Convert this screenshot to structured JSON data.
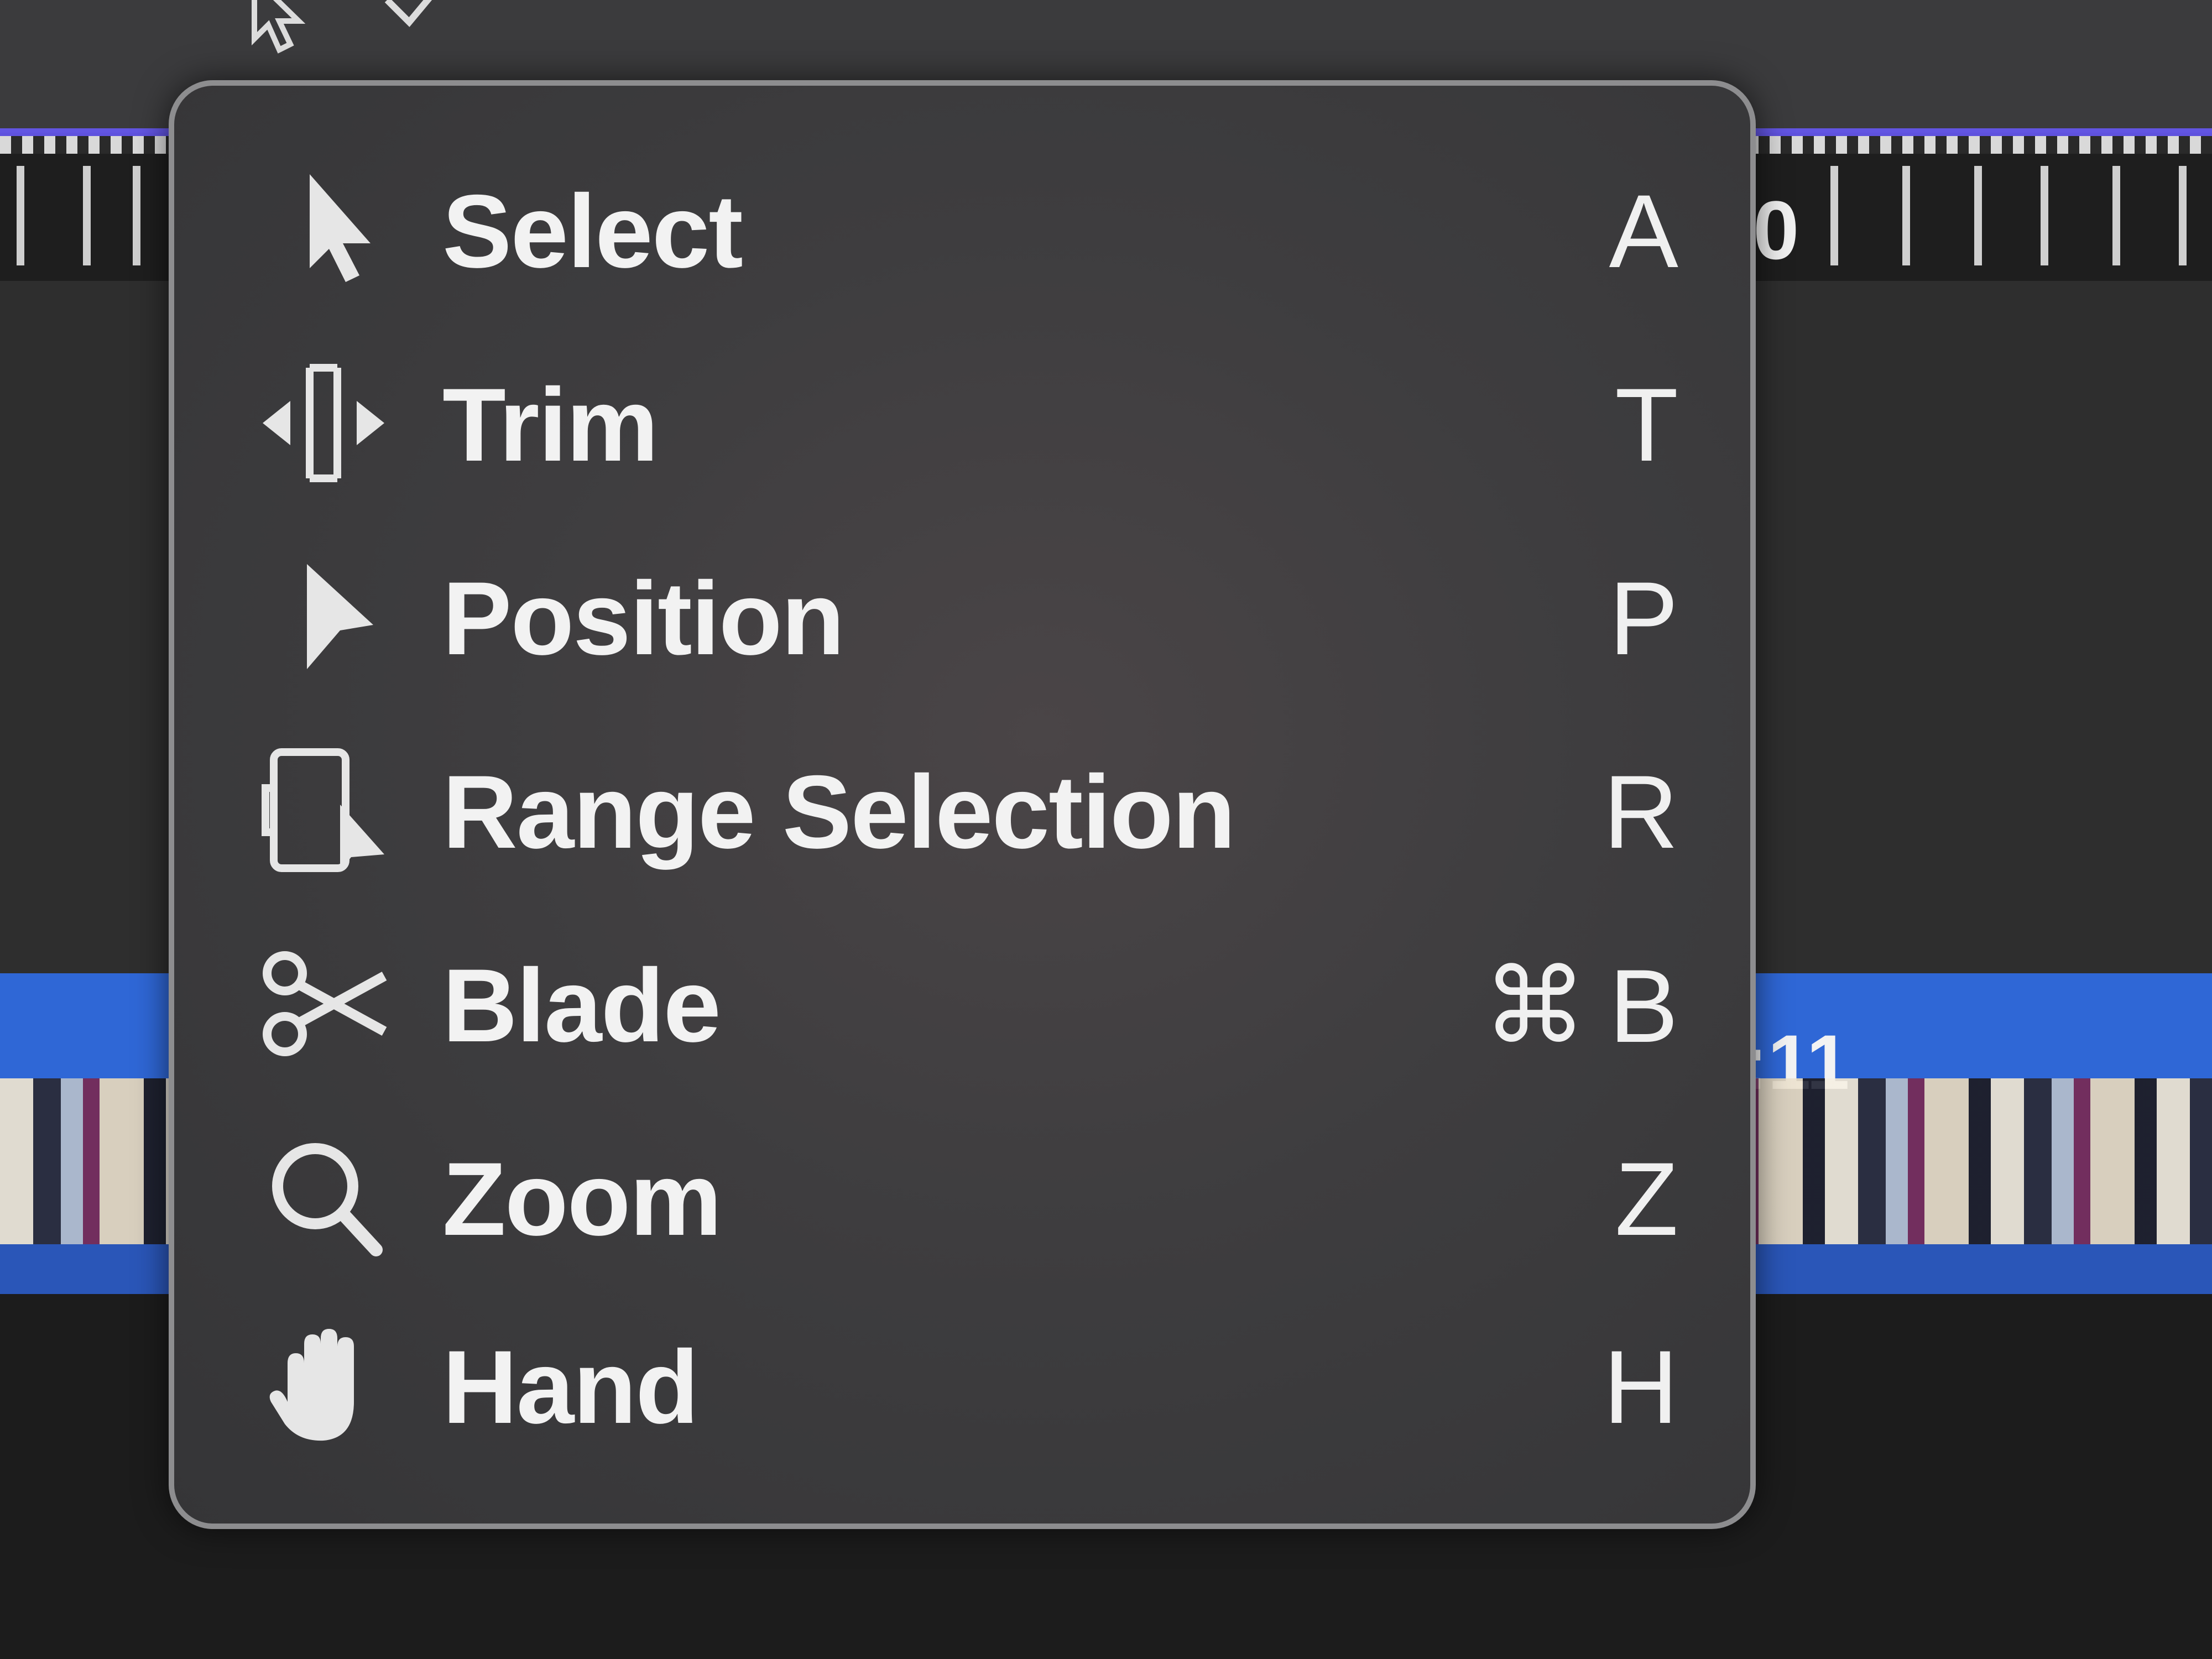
{
  "background": {
    "ruler_digit": "0",
    "track_timecode": ":11"
  },
  "menu": {
    "items": [
      {
        "label": "Select",
        "icon": "arrow-pointer-icon",
        "modifier": "",
        "key": "A"
      },
      {
        "label": "Trim",
        "icon": "trim-icon",
        "modifier": "",
        "key": "T"
      },
      {
        "label": "Position",
        "icon": "position-arrow-icon",
        "modifier": "",
        "key": "P"
      },
      {
        "label": "Range Selection",
        "icon": "range-selection-icon",
        "modifier": "",
        "key": "R"
      },
      {
        "label": "Blade",
        "icon": "scissors-icon",
        "modifier": "⌘",
        "key": "B"
      },
      {
        "label": "Zoom",
        "icon": "magnifier-icon",
        "modifier": "",
        "key": "Z"
      },
      {
        "label": "Hand",
        "icon": "hand-icon",
        "modifier": "",
        "key": "H"
      }
    ]
  },
  "colors": {
    "menu_background": "#3e3d3f",
    "menu_border": "#8d8d8f",
    "track_blue": "#2f67d6",
    "ruler_accent": "#6a5bff"
  }
}
